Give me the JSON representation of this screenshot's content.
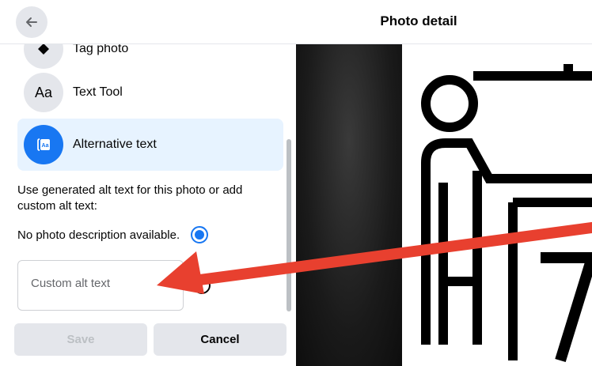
{
  "header": {
    "title": "Photo detail",
    "back_icon": "arrow-left-icon"
  },
  "menu": {
    "items": [
      {
        "label": "Tag photo",
        "icon": "tag-icon",
        "active": false
      },
      {
        "label": "Text Tool",
        "icon": "text-aa-icon",
        "icon_text": "Aa",
        "active": false
      },
      {
        "label": "Alternative text",
        "icon": "alt-text-icon",
        "active": true
      }
    ]
  },
  "alt_text": {
    "description": "Use generated alt text for this photo or add custom alt text:",
    "generated_option": "No photo description available.",
    "custom_placeholder": "Custom alt text"
  },
  "footer": {
    "save_label": "Save",
    "cancel_label": "Cancel"
  },
  "colors": {
    "accent": "#1877f2",
    "active_bg": "#e7f3ff",
    "arrow": "#e8402f"
  }
}
